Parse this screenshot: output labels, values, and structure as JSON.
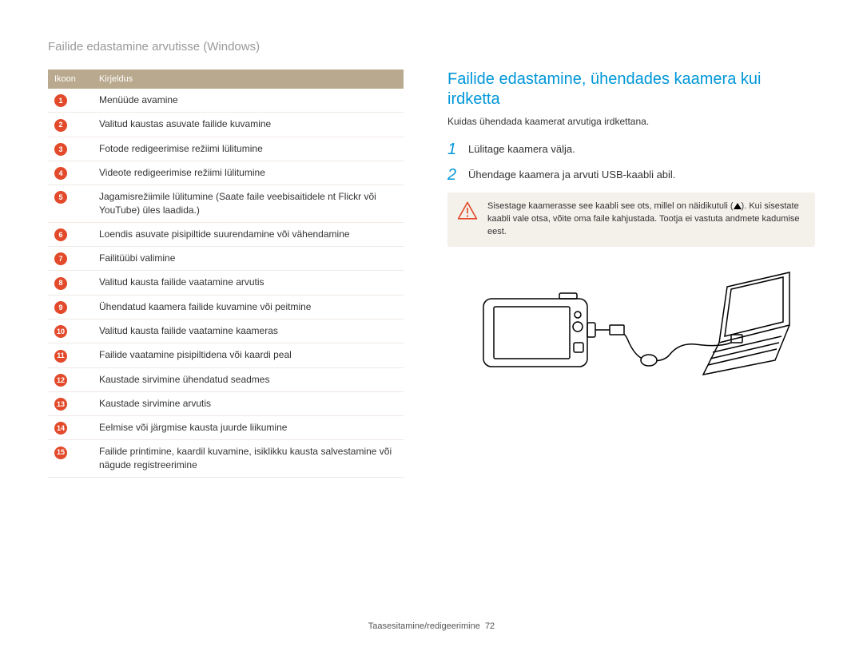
{
  "header_title": "Failide edastamine arvutisse (Windows)",
  "table": {
    "headers": [
      "Ikoon",
      "Kirjeldus"
    ],
    "rows": [
      {
        "n": "1",
        "desc": "Menüüde avamine"
      },
      {
        "n": "2",
        "desc": "Valitud kaustas asuvate failide kuvamine"
      },
      {
        "n": "3",
        "desc": "Fotode redigeerimise režiimi lülitumine"
      },
      {
        "n": "4",
        "desc": "Videote redigeerimise režiimi lülitumine"
      },
      {
        "n": "5",
        "desc": "Jagamisrežiimile lülitumine (Saate faile veebisaitidele nt Flickr või YouTube) üles laadida.)"
      },
      {
        "n": "6",
        "desc": "Loendis asuvate pisipiltide suurendamine või vähendamine"
      },
      {
        "n": "7",
        "desc": "Failitüübi valimine"
      },
      {
        "n": "8",
        "desc": "Valitud kausta failide vaatamine arvutis"
      },
      {
        "n": "9",
        "desc": "Ühendatud kaamera failide kuvamine või peitmine"
      },
      {
        "n": "10",
        "desc": "Valitud kausta failide vaatamine kaameras"
      },
      {
        "n": "11",
        "desc": "Failide vaatamine pisipiltidena või kaardi peal"
      },
      {
        "n": "12",
        "desc": "Kaustade sirvimine ühendatud seadmes"
      },
      {
        "n": "13",
        "desc": "Kaustade sirvimine arvutis"
      },
      {
        "n": "14",
        "desc": "Eelmise või järgmise kausta juurde liikumine"
      },
      {
        "n": "15",
        "desc": "Failide printimine, kaardil kuvamine, isiklikku kausta salvestamine või nägude registreerimine"
      }
    ]
  },
  "section": {
    "heading": "Failide edastamine, ühendades kaamera kui irdketta",
    "intro": "Kuidas ühendada kaamerat arvutiga irdkettana.",
    "steps": [
      {
        "num": "1",
        "text": "Lülitage kaamera välja."
      },
      {
        "num": "2",
        "text": "Ühendage kaamera ja arvuti USB-kaabli abil."
      }
    ],
    "warning_pre": "Sisestage kaamerasse see kaabli see ots, millel on näidikutuli (",
    "warning_post": "). Kui sisestate kaabli vale otsa, võite oma faile kahjustada. Tootja ei vastuta andmete kadumise eest."
  },
  "footer": {
    "label": "Taasesitamine/redigeerimine",
    "page": "72"
  }
}
